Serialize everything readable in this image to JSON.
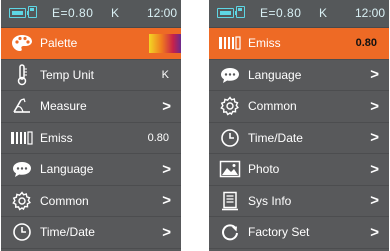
{
  "left": {
    "status": {
      "emiss": "E=0.80",
      "unit": "K",
      "time": "12:00"
    },
    "items": [
      {
        "label": "Palette",
        "icon": "palette-icon",
        "selected": true
      },
      {
        "label": "Temp Unit",
        "icon": "thermometer-icon",
        "value": "K"
      },
      {
        "label": "Measure",
        "icon": "measure-icon",
        "chevron": ">"
      },
      {
        "label": "Emiss",
        "icon": "emissivity-icon",
        "value": "0.80"
      },
      {
        "label": "Language",
        "icon": "chat-bubble-icon",
        "chevron": ">"
      },
      {
        "label": "Common",
        "icon": "gear-icon",
        "chevron": ">"
      },
      {
        "label": "Time/Date",
        "icon": "clock-icon",
        "chevron": ">"
      }
    ]
  },
  "right": {
    "status": {
      "emiss": "E=0.80",
      "unit": "K",
      "time": "12:00"
    },
    "items": [
      {
        "label": "Emiss",
        "icon": "emissivity-icon",
        "value": "0.80",
        "selected": true
      },
      {
        "label": "Language",
        "icon": "chat-bubble-icon",
        "chevron": ">"
      },
      {
        "label": "Common",
        "icon": "gear-icon",
        "chevron": ">"
      },
      {
        "label": "Time/Date",
        "icon": "clock-icon",
        "chevron": ">"
      },
      {
        "label": "Photo",
        "icon": "photo-icon",
        "chevron": ">"
      },
      {
        "label": "Sys Info",
        "icon": "document-icon",
        "chevron": ">"
      },
      {
        "label": "Factory Set",
        "icon": "reset-icon",
        "chevron": ">"
      }
    ]
  },
  "colors": {
    "selected": "#ee6a25",
    "background": "#58595b",
    "status_accent": "#5ed6e4"
  }
}
